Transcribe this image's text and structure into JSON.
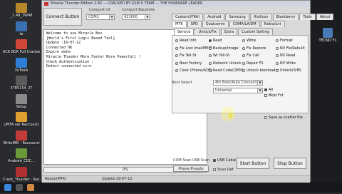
{
  "desktop": {
    "left_icons": [
      {
        "label": "_1.49_1W48",
        "color": "#b8862b"
      },
      {
        "label": "te",
        "color": "#3a6fb0"
      },
      {
        "label": "ACK BOX Full Cracked",
        "color": "#d1453a"
      },
      {
        "label": "3uTools",
        "color": "#2d7fd6"
      },
      {
        "label": "3T85154_2T",
        "color": "#5b5b5b"
      },
      {
        "label": "Setup",
        "color": "#8a8a8a"
      },
      {
        "label": "UMTA ver Raccourci",
        "color": "#e0a030"
      },
      {
        "label": "WriteMEI - Raccourci",
        "color": "#c23b3b"
      },
      {
        "label": "Android_CDC...",
        "color": "#6b9a3a"
      },
      {
        "label": "Crack_Thunder - Raccourci",
        "color": "#b03030"
      }
    ],
    "right_icons": [
      {
        "label": "TECNO F1",
        "color": "#4a7ab5"
      }
    ]
  },
  "window": {
    "title": "Miracle Thunder Edition 2.82 — CRACKED BY GSM X TEAM — THE FIRMWARE LEADER",
    "connect_button": "Connect Button",
    "comport_label": "Comport Inf",
    "comport_value": "COM1",
    "baud_label": "Comport Baudrate",
    "baud_value": "921600",
    "console_lines": [
      "Welcome to use Miracle Box",
      "[World's First Logic Based Tool]",
      "Update :19-07-12",
      "Connected OK",
      "Expire date:",
      "Miracle Thunder More Faster More Powerfull !",
      "Check Authentication :",
      "Detect connected scrn"
    ],
    "progress_text": "0%",
    "status_left": "Ready(MTK)",
    "status_mid": "Update:19-07-12",
    "top_tabs": [
      "Custom(IFRA)",
      "Android",
      "Samsung",
      "Hisilicon",
      "Blackberry",
      "Tools",
      "About"
    ],
    "second_tabs": [
      "MTK",
      "SPD",
      "Qualcomm",
      "CDMA/LA/DM",
      "Nokia/Lnt"
    ],
    "third_tabs": [
      "Service",
      "Unlock/Fix",
      "Extra",
      "Custom Setting"
    ],
    "options": [
      {
        "label": "Read Info",
        "sel": false
      },
      {
        "label": "Read",
        "sel": true
      },
      {
        "label": "Write",
        "sel": false
      },
      {
        "label": "Format",
        "sel": false
      },
      {
        "label": "Fix Lost Imei/MEID",
        "sel": false
      },
      {
        "label": "Backup/Image",
        "sel": false
      },
      {
        "label": "Fix Restore",
        "sel": false
      },
      {
        "label": "NV Fix/Rebuilt",
        "sel": false
      },
      {
        "label": "Fix Tell-St",
        "sel": false
      },
      {
        "label": "Wr Tell-St",
        "sel": false
      },
      {
        "label": "Fix Call",
        "sel": false
      },
      {
        "label": "NV Read",
        "sel": false
      },
      {
        "label": "Boot Factory",
        "sel": false
      },
      {
        "label": "Network Unlock",
        "sel": false
      },
      {
        "label": "Repair FS",
        "sel": false
      },
      {
        "label": "NV Write",
        "sel": false
      },
      {
        "label": "Clear (Phone/ADB)",
        "sel": false
      },
      {
        "label": "Read Code(OEM)",
        "sel": false
      },
      {
        "label": "Unlock bootloader",
        "sel": false
      },
      {
        "label": "Unlock(SIM)",
        "sel": false
      }
    ],
    "boot_select_label": "Boot Select",
    "boot_select_value": "4th Boot(Auto Connect)",
    "universal_value": "Universal",
    "chk_all": "All",
    "chk_bksf": "Bkpt Fst",
    "save_scatter": "Save as scatter file",
    "com_label": "COM Scan USB Scan",
    "usb_cable": "USB Cable",
    "phone_pinouts": "Phone Pinouts",
    "scan_def": "Scan Def",
    "start_button": "Start Button",
    "stop_button": "Stop Button"
  }
}
